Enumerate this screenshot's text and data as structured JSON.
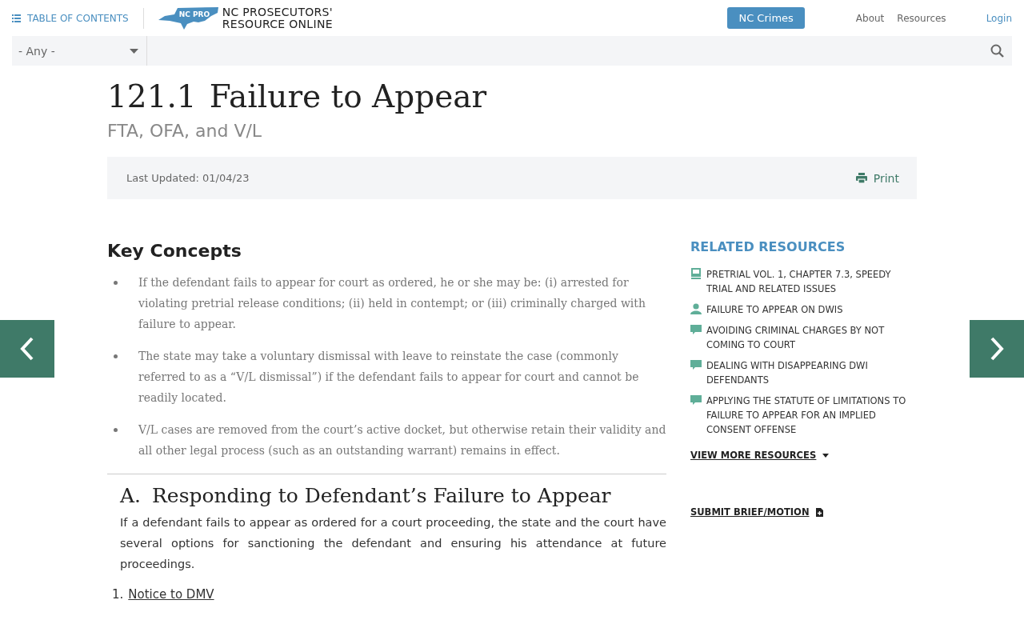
{
  "header": {
    "toc_label": "TABLE OF CONTENTS",
    "logo_badge": "NC PRO",
    "logo_line1": "NC PROSECUTORS'",
    "logo_line2": "RESOURCE ONLINE",
    "cta": "NC Crimes",
    "nav": [
      "About",
      "Resources"
    ],
    "login": "Login"
  },
  "search": {
    "filter_value": "- Any -"
  },
  "article": {
    "number": "121.1",
    "title": "Failure to Appear",
    "subtitle": "FTA, OFA, and V/L",
    "last_updated": "Last Updated: 01/04/23",
    "print": "Print",
    "key_concepts_title": "Key Concepts",
    "key_concepts": [
      "If the defendant fails to appear for court as ordered, he or she may be: (i) arrested for violating pretrial release conditions; (ii) held in contempt; or (iii) criminally charged with failure to appear.",
      "The state may take a voluntary dismissal with leave to reinstate the case (commonly referred to as a “V/L dismissal”) if the defendant fails to appear for court and cannot be readily located.",
      "V/L cases are removed from the court’s active docket, but otherwise retain their validity and all other legal process (such as an outstanding warrant) remains in effect."
    ],
    "section": {
      "letter": "A.",
      "title": "Responding to Defendant’s Failure to Appear",
      "body": "If a defendant fails to appear as ordered for a court proceeding, the state and the court have several options for sanctioning the defendant and ensuring his attendance at future proceedings."
    },
    "numbered": [
      {
        "number": "1.",
        "label": "Notice to DMV"
      }
    ]
  },
  "related": {
    "title": "RELATED RESOURCES",
    "items": [
      {
        "kind": "book",
        "label": "PRETRIAL VOL. 1, CHAPTER 7.3, SPEEDY TRIAL AND RELATED ISSUES"
      },
      {
        "kind": "person",
        "label": "FAILURE TO APPEAR ON DWIS"
      },
      {
        "kind": "comment",
        "label": "AVOIDING CRIMINAL CHARGES BY NOT COMING TO COURT"
      },
      {
        "kind": "comment",
        "label": "DEALING WITH DISAPPEARING DWI DEFENDANTS"
      },
      {
        "kind": "comment",
        "label": "APPLYING THE STATUTE OF LIMITATIONS TO FAILURE TO APPEAR FOR AN IMPLIED CONSENT OFFENSE"
      }
    ],
    "view_more": "VIEW MORE RESOURCES",
    "submit": "SUBMIT BRIEF/MOTION"
  }
}
